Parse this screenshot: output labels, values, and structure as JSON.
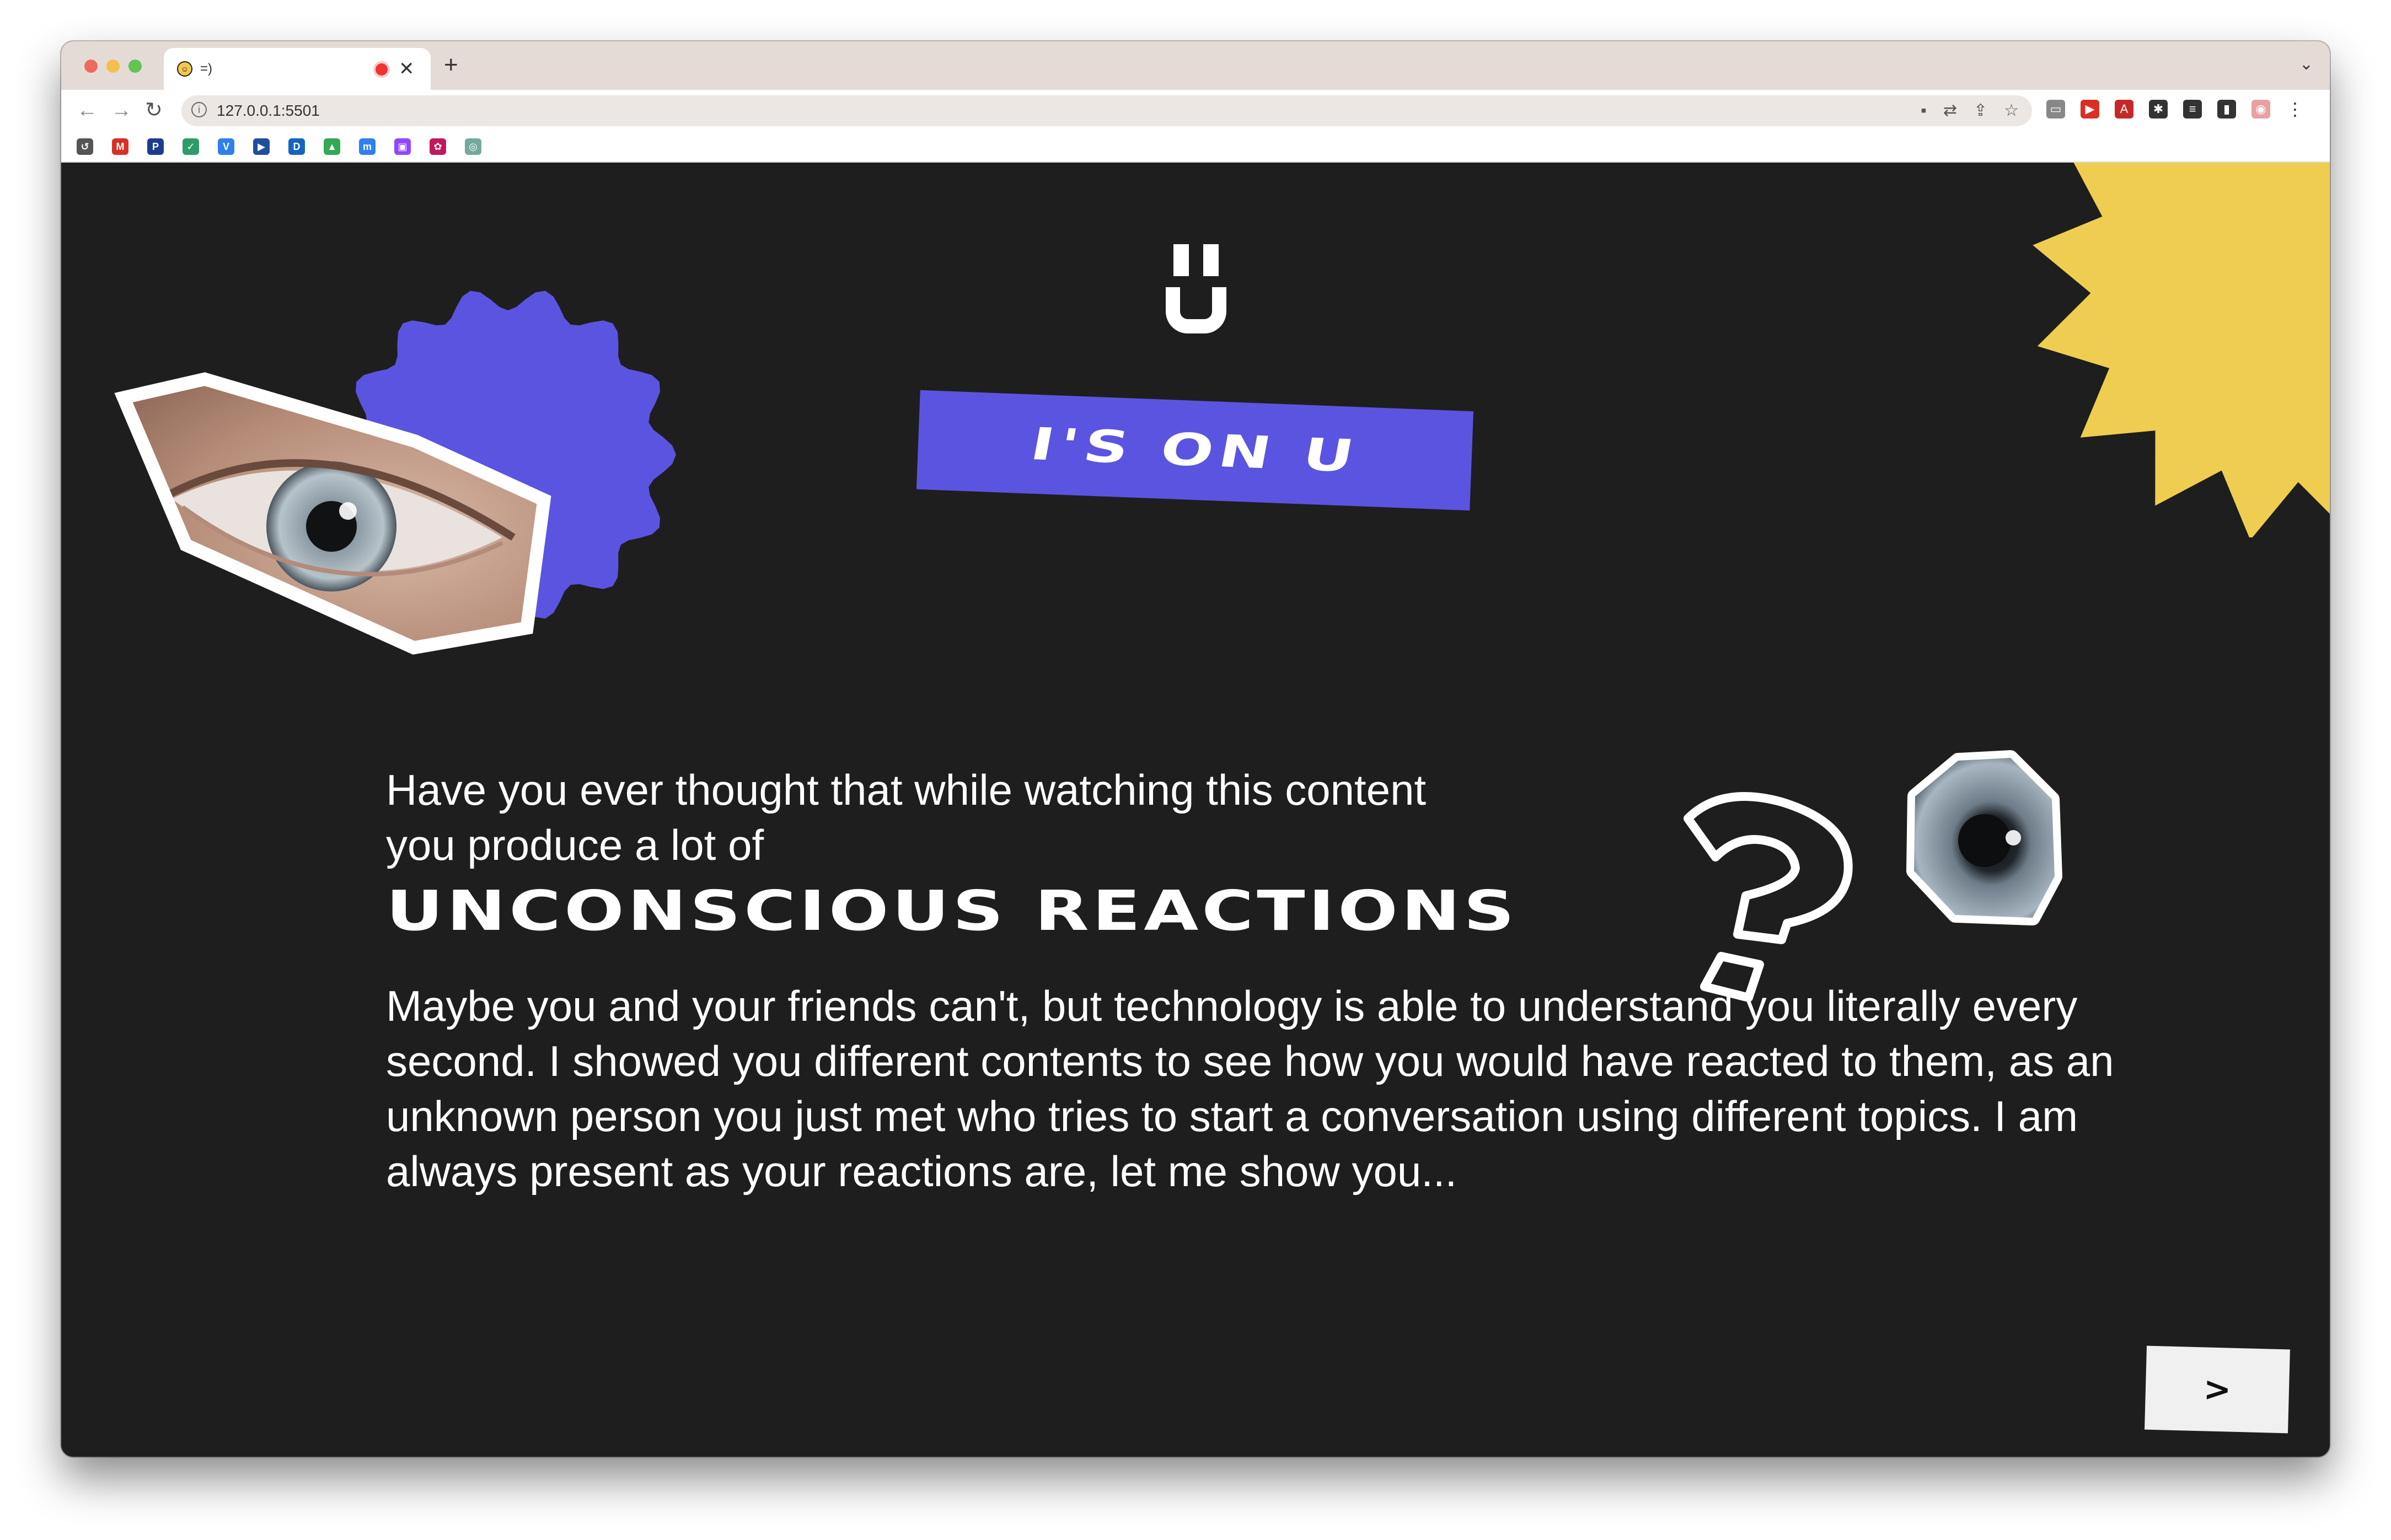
{
  "browser": {
    "tab_title": "=)",
    "tab_favicon": "☺",
    "tab_close": "✕",
    "new_tab": "+",
    "tab_menu": "⌄",
    "url": "127.0.0.1:5501",
    "nav_back": "←",
    "nav_forward": "→",
    "nav_reload": "↻",
    "omnibox_icons": [
      "camera-icon",
      "translate-icon",
      "share-icon",
      "star-icon"
    ],
    "omnibox_glyphs": [
      "▪",
      "⇄",
      "⇪",
      "☆"
    ],
    "extensions": [
      {
        "name": "cast-icon",
        "glyph": "▭",
        "color": "#888888"
      },
      {
        "name": "youtube-ext-icon",
        "glyph": "▶",
        "color": "#d93025"
      },
      {
        "name": "pdf-icon",
        "glyph": "A",
        "color": "#c62828"
      },
      {
        "name": "puzzle-icon",
        "glyph": "✱",
        "color": "#333333"
      },
      {
        "name": "reading-list-icon",
        "glyph": "≡",
        "color": "#333333"
      },
      {
        "name": "sidepanel-icon",
        "glyph": "▮",
        "color": "#333333"
      },
      {
        "name": "profile-avatar-icon",
        "glyph": "◉",
        "color": "#e8a0a0"
      },
      {
        "name": "menu-icon",
        "glyph": "⋮",
        "color": "#333333"
      }
    ],
    "bookmarks": [
      {
        "name": "history-icon",
        "glyph": "↺",
        "color": "#555555"
      },
      {
        "name": "gmail-icon",
        "glyph": "M",
        "color": "#d93025"
      },
      {
        "name": "bookmark-pj-icon",
        "glyph": "P",
        "color": "#1c3d8f"
      },
      {
        "name": "bookmark-check-icon",
        "glyph": "✓",
        "color": "#2e9b6a"
      },
      {
        "name": "bookmark-v-icon",
        "glyph": "V",
        "color": "#2f80ed"
      },
      {
        "name": "bookmark-play-icon",
        "glyph": "▶",
        "color": "#1f4e9c"
      },
      {
        "name": "bookmark-disney-icon",
        "glyph": "D",
        "color": "#1565c0"
      },
      {
        "name": "drive-icon",
        "glyph": "▲",
        "color": "#34a853"
      },
      {
        "name": "bookmark-m-icon",
        "glyph": "m",
        "color": "#2f80ed"
      },
      {
        "name": "twitch-icon",
        "glyph": "▣",
        "color": "#9146ff"
      },
      {
        "name": "bookmark-flower-icon",
        "glyph": "✿",
        "color": "#c2185b"
      },
      {
        "name": "bookmark-ai-icon",
        "glyph": "◎",
        "color": "#74aa9c"
      }
    ]
  },
  "page": {
    "badge": "I'S ON U",
    "intro": "Have you ever thought that while watching this content you produce a lot of",
    "headline": "UNCONSCIOUS REACTIONS",
    "body": "Maybe you and your friends can't, but technology is able to understand you literally every second. I showed you different contents to see how you would have reacted to them, as an unknown person you just met who tries to start a conversation using different topics. I am always present as your reactions are, let me show you...",
    "next_label": ">"
  },
  "colors": {
    "background": "#1e1e1e",
    "accent_purple": "#5b54e0",
    "accent_yellow": "#efcd50",
    "text": "#ffffff",
    "button_bg": "#f0f0f0"
  }
}
